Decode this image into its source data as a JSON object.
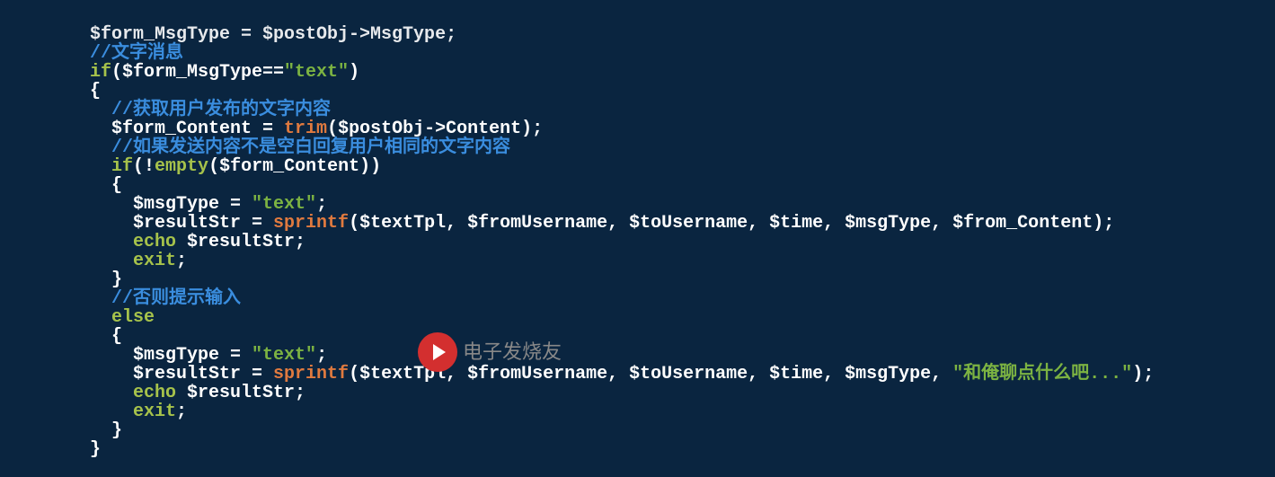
{
  "watermark_text": "电子发烧友",
  "code_lines": [
    {
      "indent": 0,
      "tokens": [
        {
          "class": "c-default",
          "text": "$form_MsgType = $postObj->MsgType;"
        }
      ],
      "partial_top": true
    },
    {
      "indent": 0,
      "tokens": []
    },
    {
      "indent": 0,
      "tokens": [
        {
          "class": "c-comment",
          "text": "//文字消息"
        }
      ]
    },
    {
      "indent": 0,
      "tokens": [
        {
          "class": "c-keyword",
          "text": "if"
        },
        {
          "class": "c-punct",
          "text": "($form_MsgType=="
        },
        {
          "class": "c-string",
          "text": "\"text\""
        },
        {
          "class": "c-punct",
          "text": ")"
        }
      ]
    },
    {
      "indent": 0,
      "tokens": [
        {
          "class": "c-punct",
          "text": "{"
        }
      ]
    },
    {
      "indent": 1,
      "tokens": [
        {
          "class": "c-comment",
          "text": "//获取用户发布的文字内容"
        }
      ]
    },
    {
      "indent": 1,
      "tokens": [
        {
          "class": "c-var",
          "text": "$form_Content = "
        },
        {
          "class": "c-func",
          "text": "trim"
        },
        {
          "class": "c-punct",
          "text": "($postObj->Content);"
        }
      ]
    },
    {
      "indent": 1,
      "tokens": [
        {
          "class": "c-comment",
          "text": "//如果发送内容不是空白回复用户相同的文字内容"
        }
      ]
    },
    {
      "indent": 1,
      "tokens": [
        {
          "class": "c-keyword",
          "text": "if"
        },
        {
          "class": "c-punct",
          "text": "(!"
        },
        {
          "class": "c-keyword",
          "text": "empty"
        },
        {
          "class": "c-punct",
          "text": "($form_Content))"
        }
      ]
    },
    {
      "indent": 1,
      "tokens": [
        {
          "class": "c-punct",
          "text": "{"
        }
      ]
    },
    {
      "indent": 2,
      "tokens": [
        {
          "class": "c-var",
          "text": "$msgType = "
        },
        {
          "class": "c-string",
          "text": "\"text\""
        },
        {
          "class": "c-punct",
          "text": ";"
        }
      ]
    },
    {
      "indent": 2,
      "tokens": [
        {
          "class": "c-var",
          "text": "$resultStr = "
        },
        {
          "class": "c-func",
          "text": "sprintf"
        },
        {
          "class": "c-punct",
          "text": "($textTpl, $fromUsername, $toUsername, $time, $msgType, $from_Content);"
        }
      ]
    },
    {
      "indent": 2,
      "tokens": [
        {
          "class": "c-keyword",
          "text": "echo"
        },
        {
          "class": "c-var",
          "text": " $resultStr;"
        }
      ]
    },
    {
      "indent": 2,
      "tokens": [
        {
          "class": "c-keyword",
          "text": "exit"
        },
        {
          "class": "c-punct",
          "text": ";"
        }
      ]
    },
    {
      "indent": 1,
      "tokens": [
        {
          "class": "c-punct",
          "text": "}"
        }
      ]
    },
    {
      "indent": 1,
      "tokens": [
        {
          "class": "c-comment",
          "text": "//否则提示输入"
        }
      ]
    },
    {
      "indent": 1,
      "tokens": [
        {
          "class": "c-keyword",
          "text": "else"
        }
      ]
    },
    {
      "indent": 1,
      "tokens": [
        {
          "class": "c-punct",
          "text": "{"
        }
      ]
    },
    {
      "indent": 2,
      "tokens": [
        {
          "class": "c-var",
          "text": "$msgType = "
        },
        {
          "class": "c-string",
          "text": "\"text\""
        },
        {
          "class": "c-punct",
          "text": ";"
        }
      ]
    },
    {
      "indent": 2,
      "tokens": [
        {
          "class": "c-var",
          "text": "$resultStr = "
        },
        {
          "class": "c-func",
          "text": "sprintf"
        },
        {
          "class": "c-punct",
          "text": "($textTpl, $fromUsername, $toUsername, $time, $msgType, "
        },
        {
          "class": "c-string",
          "text": "\"和俺聊点什么吧...\""
        },
        {
          "class": "c-punct",
          "text": ");"
        }
      ]
    },
    {
      "indent": 2,
      "tokens": [
        {
          "class": "c-keyword",
          "text": "echo"
        },
        {
          "class": "c-var",
          "text": " $resultStr;"
        }
      ]
    },
    {
      "indent": 2,
      "tokens": [
        {
          "class": "c-keyword",
          "text": "exit"
        },
        {
          "class": "c-punct",
          "text": ";"
        }
      ]
    },
    {
      "indent": 1,
      "tokens": [
        {
          "class": "c-punct",
          "text": "}"
        }
      ]
    },
    {
      "indent": 0,
      "tokens": [
        {
          "class": "c-punct",
          "text": "}"
        }
      ]
    }
  ]
}
